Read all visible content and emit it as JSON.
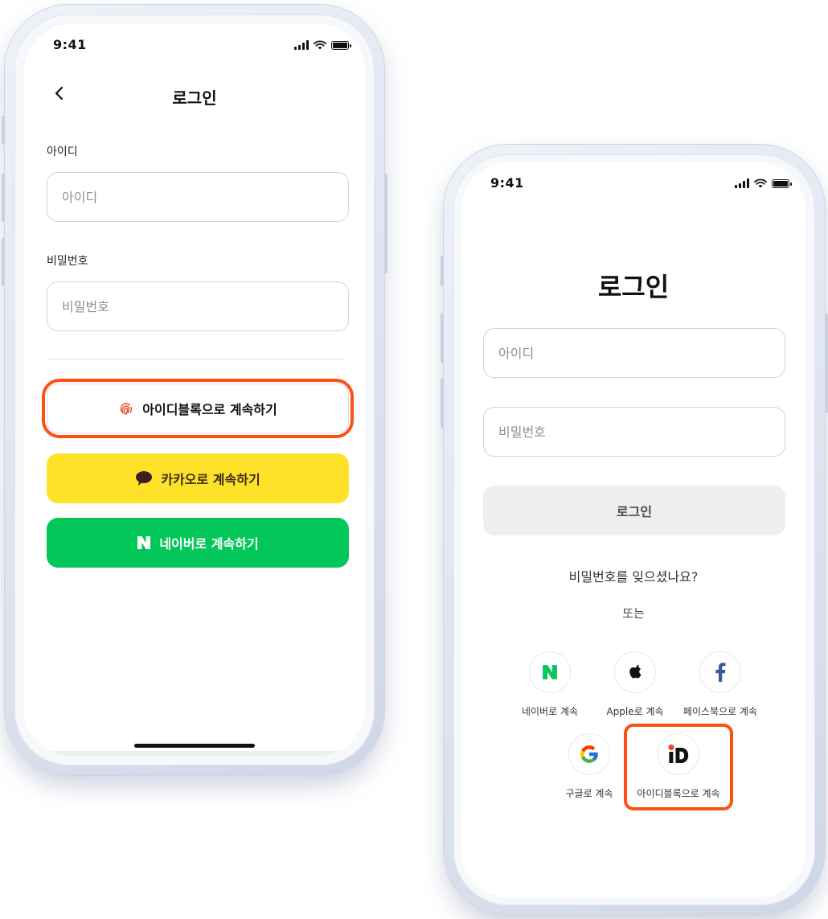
{
  "status_bar": {
    "time": "9:41"
  },
  "left_screen": {
    "title": "로그인",
    "id_label": "아이디",
    "id_placeholder": "아이디",
    "password_label": "비밀번호",
    "password_placeholder": "비밀번호",
    "buttons": {
      "idblock": "아이디블록으로 계속하기",
      "kakao": "카카오로 계속하기",
      "naver": "네이버로 계속하기"
    }
  },
  "right_screen": {
    "title": "로그인",
    "id_placeholder": "아이디",
    "password_placeholder": "비밀번호",
    "login_button": "로그인",
    "forgot_password": "비밀번호를 잊으셨나요?",
    "or_text": "또는",
    "sns": {
      "naver": "네이버로 계속",
      "apple": "Apple로 계속",
      "facebook": "페이스북으로 계속",
      "google": "구글로 계속",
      "idblock": "아이디블록으로 계속"
    }
  },
  "colors": {
    "highlight": "#fc5112",
    "kakao": "#fee22a",
    "naver": "#04c75a",
    "facebook": "#3b5998"
  }
}
